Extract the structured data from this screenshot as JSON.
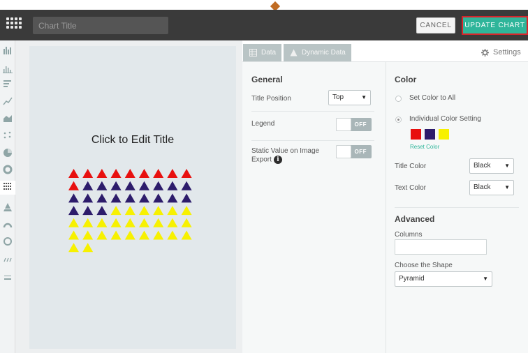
{
  "header": {
    "title_placeholder": "Chart Title",
    "cancel_label": "CANCEL",
    "update_label": "UPDATE CHART",
    "update_color": "#2fb59a",
    "highlight_color": "#d8232a"
  },
  "rail": {
    "icons": [
      "bar-chart-icon",
      "histogram-icon",
      "horizontal-bar-icon",
      "line-chart-icon",
      "area-chart-icon",
      "scatter-icon",
      "pie-chart-icon",
      "donut-chart-icon",
      "pictograph-icon",
      "pyramid-icon",
      "gauge-icon",
      "circle-icon",
      "sparkline-icon",
      "progress-icon"
    ],
    "active": "pictograph-icon"
  },
  "canvas": {
    "title": "Click to Edit Title"
  },
  "chart_data": {
    "type": "pictograph",
    "shape": "Pyramid",
    "columns": 9,
    "series": [
      {
        "color": "#e8100f",
        "count": 10
      },
      {
        "color": "#2d1c6b",
        "count": 20
      },
      {
        "color": "#f7f100",
        "count": 26
      }
    ]
  },
  "tabs": {
    "data_label": "Data",
    "dynamic_label": "Dynamic Data",
    "settings_label": "Settings"
  },
  "general": {
    "heading": "General",
    "title_position_label": "Title Position",
    "title_position_value": "Top",
    "legend_label": "Legend",
    "legend_toggle": "OFF",
    "static_value_label_line1": "Static Value on Image",
    "static_value_label_line2": "Export",
    "static_value_toggle": "OFF",
    "info_glyph": "i"
  },
  "color": {
    "heading": "Color",
    "set_all_label": "Set Color to All",
    "individual_label": "Individual Color Setting",
    "swatches": [
      "#e8100f",
      "#2d1c6b",
      "#f7f100"
    ],
    "reset_label": "Reset Color",
    "title_color_label": "Title Color",
    "title_color_value": "Black",
    "text_color_label": "Text Color",
    "text_color_value": "Black"
  },
  "advanced": {
    "heading": "Advanced",
    "columns_label": "Columns",
    "columns_value": "",
    "shape_label": "Choose the Shape",
    "shape_value": "Pyramid"
  }
}
